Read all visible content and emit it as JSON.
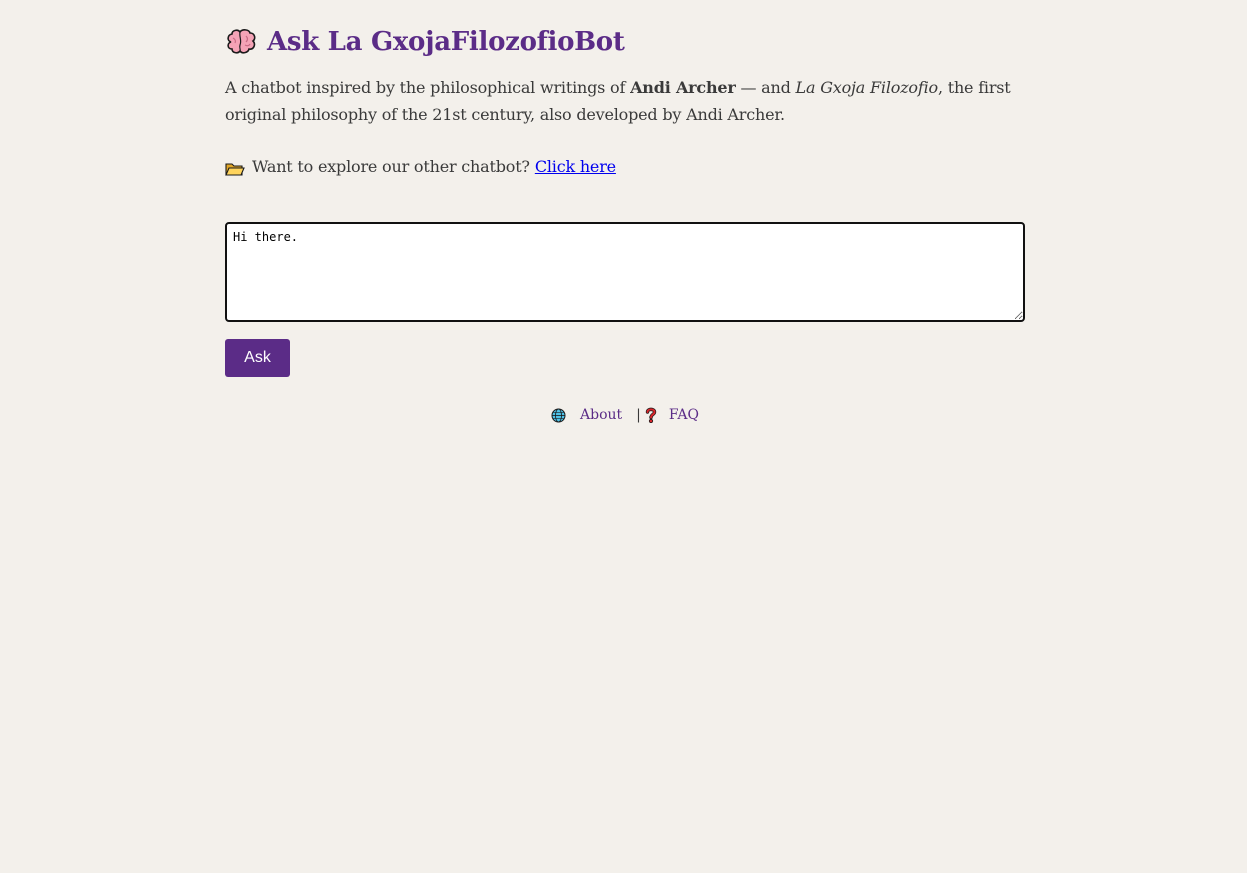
{
  "header": {
    "title": "Ask La GxojaFilozofioBot",
    "icon": "brain-icon"
  },
  "intro": {
    "part1": "A chatbot inspired by the philosophical writings of ",
    "author_bold": "Andi Archer",
    "part2": " — and ",
    "philosophy_italic": "La Gxoja Filozofio",
    "part3": ", the first original philosophy of the 21st century, also developed by Andi Archer."
  },
  "explore": {
    "icon": "folder-icon",
    "text": "Want to explore our other chatbot?",
    "link_label": "Click here"
  },
  "question": {
    "value": "Hi there."
  },
  "ask_button": {
    "label": "Ask"
  },
  "footer": {
    "about_icon": "globe-icon",
    "about_label": "About",
    "separator": "|",
    "faq_icon": "question-mark-icon",
    "faq_label": "FAQ"
  },
  "colors": {
    "accent": "#5b2c87",
    "background": "#f3f0eb",
    "link": "#0000ee"
  }
}
